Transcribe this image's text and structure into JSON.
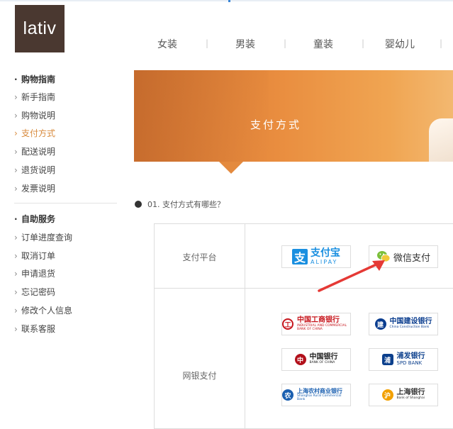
{
  "brand": {
    "logo_text": "lativ"
  },
  "nav": {
    "items": [
      "女装",
      "男装",
      "童装",
      "婴幼儿"
    ]
  },
  "sidebar": {
    "section1_title": "购物指南",
    "section1_items": [
      "新手指南",
      "购物说明",
      "支付方式",
      "配送说明",
      "退货说明",
      "发票说明"
    ],
    "section2_title": "自助服务",
    "section2_items": [
      "订单进度查询",
      "取消订单",
      "申请退货",
      "忘记密码",
      "修改个人信息",
      "联系客服"
    ],
    "active_item": "支付方式"
  },
  "banner": {
    "title": "支付方式"
  },
  "faq": {
    "question": "01. 支付方式有哪些？"
  },
  "payment_table": {
    "rows": [
      {
        "label": "支付平台"
      },
      {
        "label": "网银支付"
      }
    ],
    "platforms": {
      "alipay": {
        "cn": "支付宝",
        "en": "ALIPAY",
        "mark": "支"
      },
      "wechat": {
        "cn": "微信支付"
      }
    },
    "banks": [
      {
        "cn": "中国工商银行",
        "en": "INDUSTRIAL AND COMMERCIAL BANK OF CHINA",
        "color": "#c7161d",
        "icon": "icbc-icon",
        "mark": "工"
      },
      {
        "cn": "中国建设银行",
        "en": "China Construction Bank",
        "color": "#0a3d8f",
        "icon": "ccb-icon",
        "mark": "建"
      },
      {
        "cn": "中国银行",
        "en": "BANK OF CHINA",
        "color": "#b2101b",
        "icon": "boc-icon",
        "mark": "中"
      },
      {
        "cn": "浦发银行",
        "en": "SPD BANK",
        "color": "#0b3f8c",
        "icon": "spdb-icon",
        "mark": "浦"
      },
      {
        "cn": "上海农村商业银行",
        "en": "Shanghai Rural Commercial Bank",
        "color": "#1a5fb0",
        "icon": "srcb-icon",
        "mark": "农"
      },
      {
        "cn": "上海银行",
        "en": "Bank of Shanghai",
        "color": "#f2a000",
        "icon": "bos-icon",
        "mark": "沪"
      }
    ]
  },
  "colors": {
    "accent": "#d88a3c",
    "logo_bg": "#4a3830",
    "banner": "#e98d3f",
    "annotation_arrow": "#e53935"
  }
}
